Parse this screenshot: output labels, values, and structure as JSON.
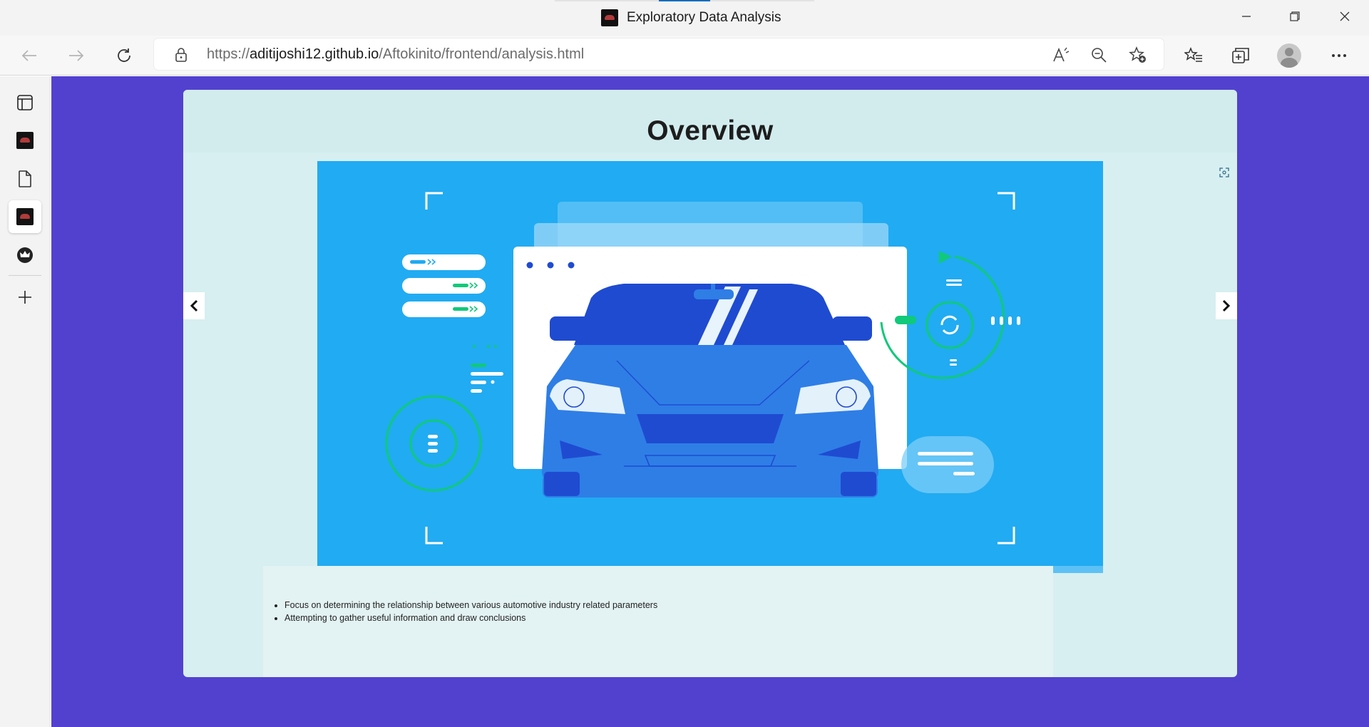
{
  "window": {
    "title": "Exploratory Data Analysis",
    "controls": {
      "minimize": "minimize",
      "maximize": "restore",
      "close": "close"
    }
  },
  "navbar": {
    "url_scheme": "https://",
    "url_host": "aditijoshi12.github.io",
    "url_path": "/Aftokinito/frontend/analysis.html",
    "icons": [
      "back-icon",
      "forward-icon",
      "refresh-icon",
      "lock-icon",
      "read-aloud-icon",
      "zoom-out-icon",
      "add-favorite-icon",
      "favorites-icon",
      "collections-icon",
      "profile-icon",
      "more-icon"
    ]
  },
  "sidebar": {
    "items": [
      "tab-actions",
      "tab-aftokinito-1",
      "tab-document",
      "tab-aftokinito-2",
      "tab-crown-app",
      "add-tab"
    ]
  },
  "slide": {
    "title": "Overview",
    "bullets": [
      "Focus on determining the relationship between various automotive industry related parameters",
      "Attempting to gather useful information and draw conclusions"
    ]
  },
  "colors": {
    "page_bg": "#5241cf",
    "card_bg": "#d7eff1",
    "illustration_bg": "#21abf2",
    "car_dark": "#1f4bd1",
    "accent_green": "#10c97a"
  }
}
